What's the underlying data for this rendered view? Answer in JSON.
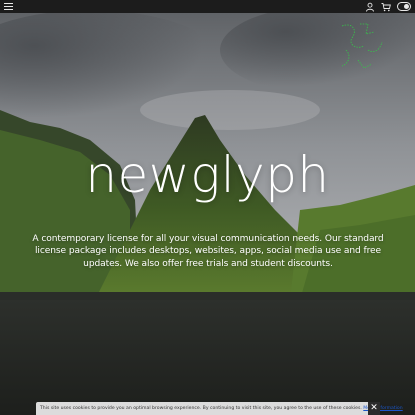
{
  "header": {
    "menu_icon": "hamburger-menu-icon",
    "account_icon": "user-icon",
    "cart_icon": "cart-icon",
    "toggle_icon": "theme-toggle-icon"
  },
  "hero": {
    "title": "newglyph",
    "description": "A contemporary license for all your visual communication needs. Our standard license package includes desktops, websites, apps, social media use and free updates. We also offer free trials and student discounts."
  },
  "cookie_banner": {
    "text": "This site uses cookies to provide you an optimal browsing experience. By continuing to visit this site, you agree to the use of these cookies. ",
    "link_label": "More information",
    "close_label": "✕"
  },
  "colors": {
    "topbar": "#1c1c1c",
    "sky": "#8c8f93",
    "grass": "#4f6f2c",
    "ground": "#222421",
    "accent_deco": "#37c24a"
  }
}
